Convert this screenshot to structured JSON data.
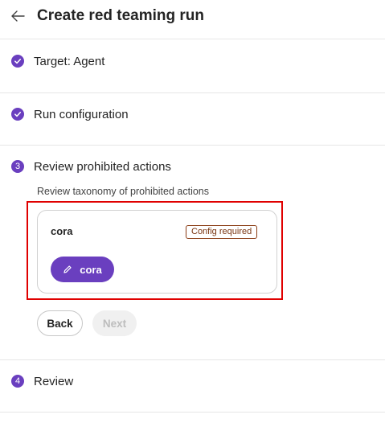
{
  "header": {
    "title": "Create red teaming run",
    "back_icon": "arrow-left-icon"
  },
  "steps": [
    {
      "icon": "check-circle-icon",
      "number": "",
      "label": "Target: Agent",
      "state": "complete"
    },
    {
      "icon": "check-circle-icon",
      "number": "",
      "label": "Run configuration",
      "state": "complete"
    },
    {
      "icon": "numbered-circle-icon",
      "number": "3",
      "label": "Review prohibited actions",
      "state": "active"
    },
    {
      "icon": "numbered-circle-icon",
      "number": "4",
      "label": "Review",
      "state": "pending"
    }
  ],
  "review_section": {
    "subtitle": "Review taxonomy of prohibited actions",
    "card": {
      "title": "cora",
      "badge": "Config required",
      "button_label": "cora",
      "button_icon": "pencil-icon"
    }
  },
  "actions": {
    "back_label": "Back",
    "next_label": "Next",
    "next_enabled": false
  },
  "colors": {
    "accent": "#6a3fbf",
    "badge_border": "#8a3c14",
    "highlight": "#e00000"
  }
}
